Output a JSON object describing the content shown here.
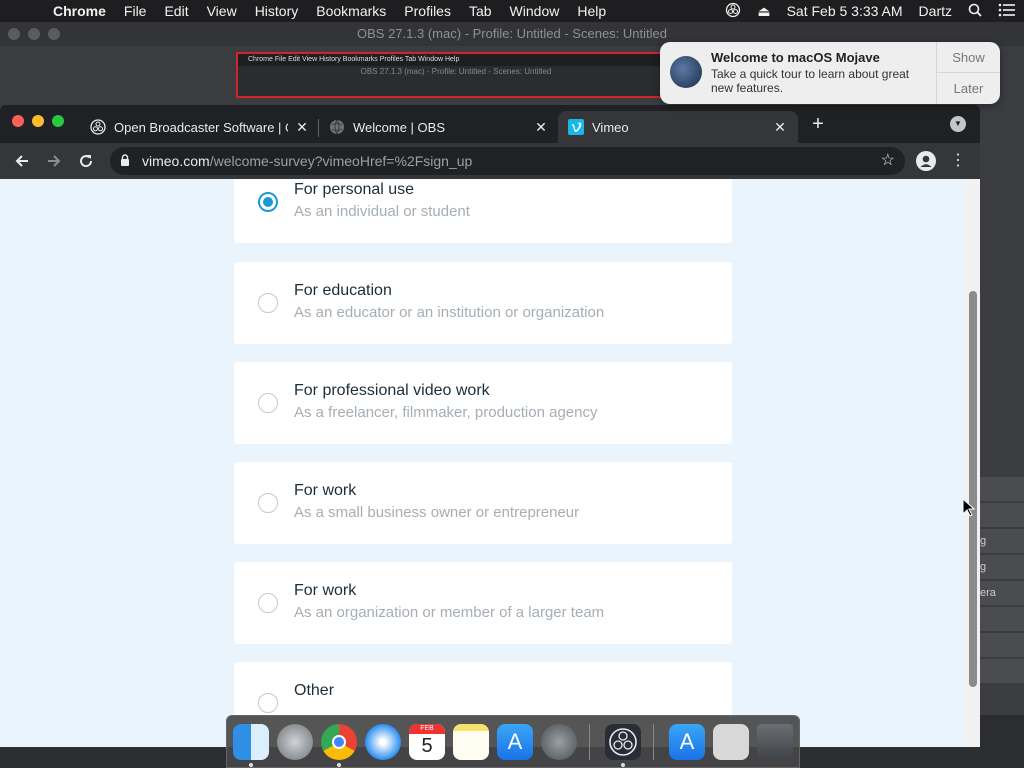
{
  "menubar": {
    "app_name": "Chrome",
    "items": [
      "File",
      "Edit",
      "View",
      "History",
      "Bookmarks",
      "Profiles",
      "Tab",
      "Window",
      "Help"
    ],
    "datetime": "Sat Feb 5  3:33 AM",
    "user": "Dartz"
  },
  "obs": {
    "title": "OBS 27.1.3 (mac) - Profile: Untitled - Scenes: Untitled",
    "preview_menu": "Chrome  File  Edit  View  History  Bookmarks  Profiles  Tab  Window  Help",
    "preview_title": "OBS 27.1.3 (mac) - Profile: Untitled - Scenes: Untitled",
    "side_items": [
      "g",
      "g",
      "era"
    ]
  },
  "notification": {
    "title": "Welcome to macOS Mojave",
    "body": "Take a quick tour to learn about great new features.",
    "show_label": "Show",
    "later_label": "Later"
  },
  "chrome": {
    "tabs": [
      {
        "title": "Open Broadcaster Software | OBS",
        "close": "✕"
      },
      {
        "title": "Welcome | OBS",
        "close": "✕"
      },
      {
        "title": "Vimeo",
        "close": "✕"
      }
    ],
    "new_tab": "+",
    "url_host": "vimeo.com",
    "url_path": "/welcome-survey?vimeoHref=%2Fsign_up"
  },
  "survey": {
    "options": [
      {
        "title": "For personal use",
        "subtitle": "As an individual or student",
        "selected": true
      },
      {
        "title": "For education",
        "subtitle": "As an educator or an institution or organization",
        "selected": false
      },
      {
        "title": "For professional video work",
        "subtitle": "As a freelancer, filmmaker, production agency",
        "selected": false
      },
      {
        "title": "For work",
        "subtitle": "As a small business owner or entrepreneur",
        "selected": false
      },
      {
        "title": "For work",
        "subtitle": "As an organization or member of a larger team",
        "selected": false
      },
      {
        "title": "Other",
        "subtitle": "",
        "selected": false
      }
    ]
  },
  "dock": {
    "calendar_month": "FEB",
    "calendar_day": "5"
  },
  "colors": {
    "accent": "#1a9bd7",
    "page_bg": "#e9f4fc"
  }
}
